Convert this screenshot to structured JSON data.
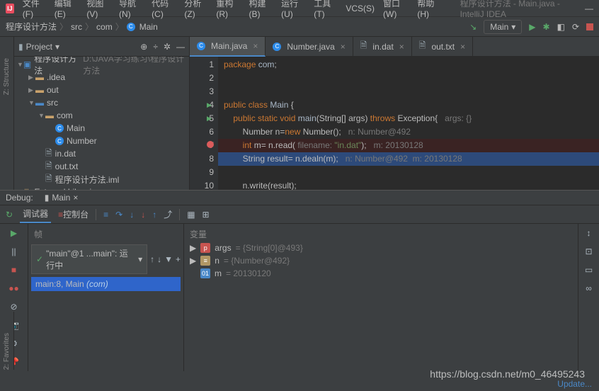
{
  "title": "程序设计方法 - Main.java - IntelliJ IDEA",
  "menu": [
    "文件(F)",
    "编辑(E)",
    "视图(V)",
    "导航(N)",
    "代码(C)",
    "分析(Z)",
    "重构(R)",
    "构建(B)",
    "运行(U)",
    "工具(T)",
    "VCS(S)",
    "窗口(W)",
    "帮助(H)"
  ],
  "breadcrumb": {
    "project": "程序设计方法",
    "src": "src",
    "pkg": "com",
    "cls": "Main"
  },
  "run_config": "Main",
  "project_panel": {
    "title": "Project",
    "root": "程序设计方法",
    "root_path": "D:\\JAVA学习练习\\程序设计方法",
    "idea": ".idea",
    "out": "out",
    "src": "src",
    "com": "com",
    "main": "Main",
    "number": "Number",
    "in": "in.dat",
    "out_txt": "out.txt",
    "iml": "程序设计方法.iml",
    "ext": "External Libraries"
  },
  "sidebar": {
    "structure": "Z: Structure",
    "favorites": "2: Favorites"
  },
  "tabs": [
    {
      "label": "Main.java",
      "active": true
    },
    {
      "label": "Number.java",
      "active": false
    },
    {
      "label": "in.dat",
      "active": false
    },
    {
      "label": "out.txt",
      "active": false
    }
  ],
  "code": {
    "l1": "package com;",
    "l4": "public class Main {",
    "l5_pre": "    public static void main(String[] args) throws Exception{",
    "l5_hint": "   args: {}",
    "l6_pre": "        Number n=new Number();",
    "l6_hint": "   n: Number@492",
    "l7_pre": "        int m= n.read(",
    "l7_hint": " filename: ",
    "l7_str": "\"in.dat\"",
    "l7_post": ");",
    "l7_cmt": "   m: 20130128",
    "l8_pre": "        String result= n.dealn(m);",
    "l8_cmt": "   n: Number@492  m: 20130128",
    "l10": "        n.write(result);"
  },
  "debug": {
    "tab": "Debug:",
    "run": "Main",
    "debugger": "调试器",
    "console": "控制台",
    "frames_header": "帧",
    "vars_header": "变量",
    "thread": "\"main\"@1 ...main\": 运行中",
    "frame": "main:8, Main",
    "frame_pkg": "(com)",
    "args_name": "args",
    "args_val": "= {String[0]@493}",
    "n_name": "n",
    "n_val": "= {Number@492}",
    "m_name": "m",
    "m_val": "= 20130120"
  },
  "watermark": "https://blog.csdn.net/m0_46495243",
  "status": {
    "update": "Update..."
  }
}
